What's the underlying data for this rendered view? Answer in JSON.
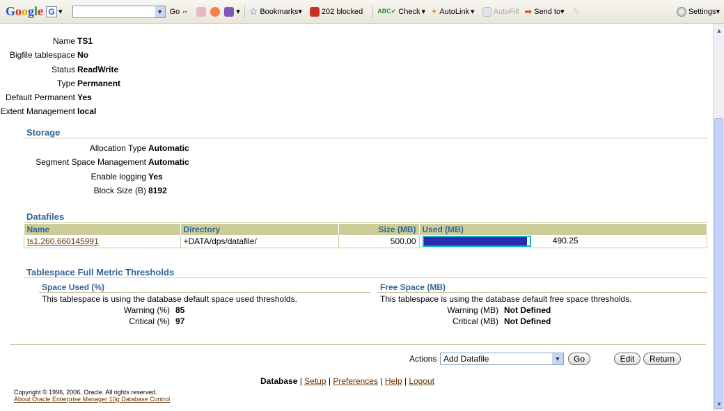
{
  "toolbar": {
    "logo": [
      "G",
      "o",
      "o",
      "g",
      "l",
      "e"
    ],
    "g_box": "G",
    "go_label": "Go",
    "bookmarks_label": "Bookmarks",
    "blocked_label": "202 blocked",
    "check_label": "Check",
    "autolink_label": "AutoLink",
    "autofill_label": "AutoFill",
    "sendto_label": "Send to",
    "settings_label": "Settings"
  },
  "general": {
    "rows": [
      {
        "label": "Name",
        "value": "TS1"
      },
      {
        "label": "Bigfile tablespace",
        "value": "No"
      },
      {
        "label": "Status",
        "value": "ReadWrite"
      },
      {
        "label": "Type",
        "value": "Permanent"
      },
      {
        "label": "Default Permanent",
        "value": "Yes"
      },
      {
        "label": "Extent Management",
        "value": "local"
      }
    ]
  },
  "storage": {
    "title": "Storage",
    "rows": [
      {
        "label": "Allocation Type",
        "value": "Automatic"
      },
      {
        "label": "Segment Space Management",
        "value": "Automatic"
      },
      {
        "label": "Enable logging",
        "value": "Yes"
      },
      {
        "label": "Block Size (B)",
        "value": "8192"
      }
    ]
  },
  "datafiles": {
    "title": "Datafiles",
    "headers": [
      "Name",
      "Directory",
      "Size (MB)",
      "Used (MB)"
    ],
    "rows": [
      {
        "name": "ts1.260.660145991",
        "directory": "+DATA/dps/datafile/",
        "size": "500.00",
        "used": "490.25",
        "used_fraction": 0.98
      }
    ]
  },
  "thresholds": {
    "title": "Tablespace Full Metric Thresholds",
    "space_used": {
      "title": "Space Used (%)",
      "note": "This tablespace is using the database default space used thresholds.",
      "warning_label": "Warning (%)",
      "warning_value": "85",
      "critical_label": "Critical (%)",
      "critical_value": "97"
    },
    "free_space": {
      "title": "Free Space (MB)",
      "note": "This tablespace is using the database default free space thresholds.",
      "warning_label": "Warning (MB)",
      "warning_value": "Not Defined",
      "critical_label": "Critical (MB)",
      "critical_value": "Not Defined"
    }
  },
  "actions": {
    "label": "Actions",
    "selected": "Add Datafile",
    "go": "Go",
    "edit": "Edit",
    "return": "Return"
  },
  "footer": {
    "current": "Database",
    "links": [
      "Setup",
      "Preferences",
      "Help",
      "Logout"
    ],
    "copyright": "Copyright © 1996, 2006, Oracle. All rights reserved.",
    "about": "About Oracle Enterprise Manager 10g Database Control"
  }
}
